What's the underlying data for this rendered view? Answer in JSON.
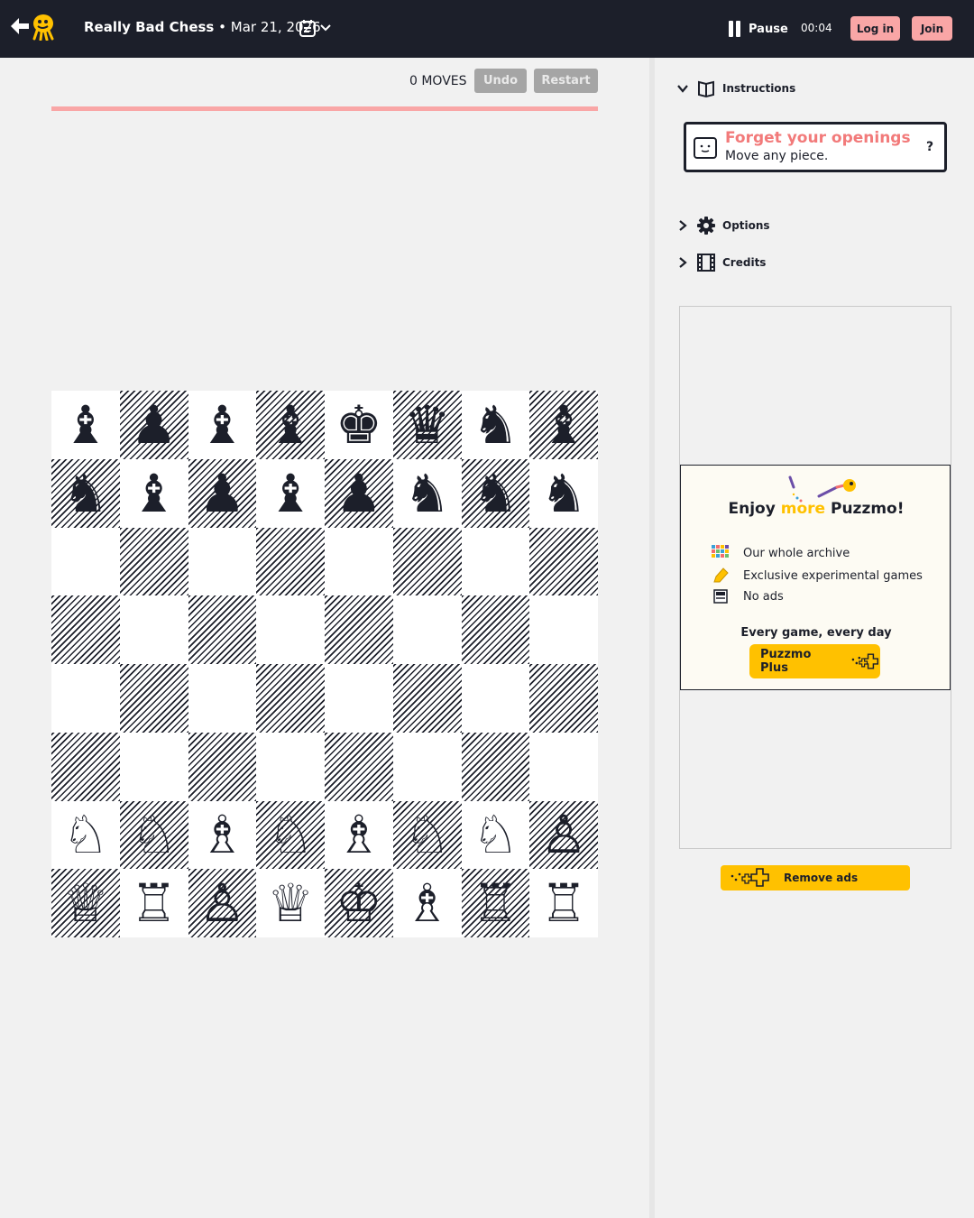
{
  "header": {
    "game_title": "Really Bad Chess",
    "date": " • Mar 21, 2026",
    "pause_label": "Pause",
    "timer": "00:04",
    "login_label": "Log in",
    "join_label": "Join"
  },
  "game": {
    "moves_label": "0 MOVES",
    "undo_label": "Undo",
    "restart_label": "Restart",
    "progress": 0
  },
  "board": {
    "ranks": [
      [
        "b",
        "p",
        "b",
        "b",
        "k",
        "q",
        "n",
        "b"
      ],
      [
        "n",
        "b",
        "p",
        "b",
        "p",
        "n",
        "n",
        "n"
      ],
      [
        "",
        "",
        "",
        "",
        "",
        "",
        "",
        ""
      ],
      [
        "",
        "",
        "",
        "",
        "",
        "",
        "",
        ""
      ],
      [
        "",
        "",
        "",
        "",
        "",
        "",
        "",
        ""
      ],
      [
        "",
        "",
        "",
        "",
        "",
        "",
        "",
        ""
      ],
      [
        "N",
        "N",
        "B",
        "N",
        "B",
        "N",
        "N",
        "P"
      ],
      [
        "Q",
        "R",
        "P",
        "Q",
        "K",
        "B",
        "R",
        "R"
      ]
    ]
  },
  "sidebar": {
    "instructions_label": "Instructions",
    "rule_title": "Forget your openings",
    "rule_desc": "Move any piece.",
    "help_label": "?",
    "options_label": "Options",
    "credits_label": "Credits"
  },
  "promo": {
    "title_pre": "Enjoy ",
    "title_more": "more",
    "title_post": " Puzzmo!",
    "features": [
      "Our whole archive",
      "Exclusive experimental games",
      "No ads"
    ],
    "tagline": "Every game, every day",
    "button_label": "Puzzmo Plus"
  },
  "remove_ads_label": "Remove ads",
  "colors": {
    "header_bg": "#1c1f2a",
    "pink": "#f9a6a6",
    "accent_yellow": "#ffc100",
    "rule_title": "#f27a7a"
  }
}
